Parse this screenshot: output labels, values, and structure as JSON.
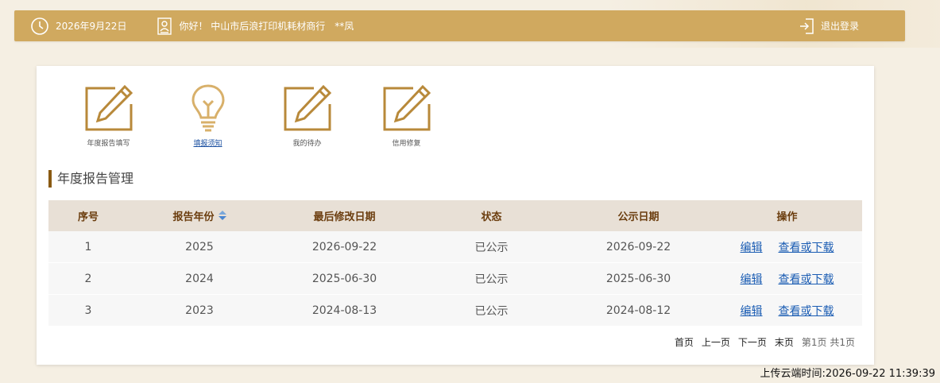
{
  "topbar": {
    "date": "2026年9月22日",
    "greeting": "你好！ 中山市后浪打印机耗材商行",
    "user": "**凤",
    "logout": "退出登录"
  },
  "quick_links": [
    {
      "label": "年度报告填写",
      "icon": "edit-box-icon"
    },
    {
      "label": "填报须知",
      "icon": "lightbulb-icon"
    },
    {
      "label": "我的待办",
      "icon": "edit-box-icon"
    },
    {
      "label": "信用修复",
      "icon": "edit-box-icon"
    }
  ],
  "section_title": "年度报告管理",
  "table": {
    "headers": [
      "序号",
      "报告年份",
      "最后修改日期",
      "状态",
      "公示日期",
      "操作"
    ],
    "rows": [
      {
        "no": "1",
        "year": "2025",
        "modified": "2026-09-22",
        "status": "已公示",
        "publish": "2026-09-22",
        "edit": "编辑",
        "view": "查看或下载"
      },
      {
        "no": "2",
        "year": "2024",
        "modified": "2025-06-30",
        "status": "已公示",
        "publish": "2025-06-30",
        "edit": "编辑",
        "view": "查看或下载"
      },
      {
        "no": "3",
        "year": "2023",
        "modified": "2024-08-13",
        "status": "已公示",
        "publish": "2024-08-12",
        "edit": "编辑",
        "view": "查看或下载"
      }
    ]
  },
  "pager": {
    "first": "首页",
    "prev": "上一页",
    "next": "下一页",
    "last": "末页",
    "info": "第1页 共1页"
  },
  "upload_time": "上传云端时间:2026-09-22 11:39:39",
  "colors": {
    "topbar": "#d0a95f",
    "icon_gold": "#b8893a",
    "header_bg": "#e8e0d6",
    "link": "#1a5cb3"
  }
}
